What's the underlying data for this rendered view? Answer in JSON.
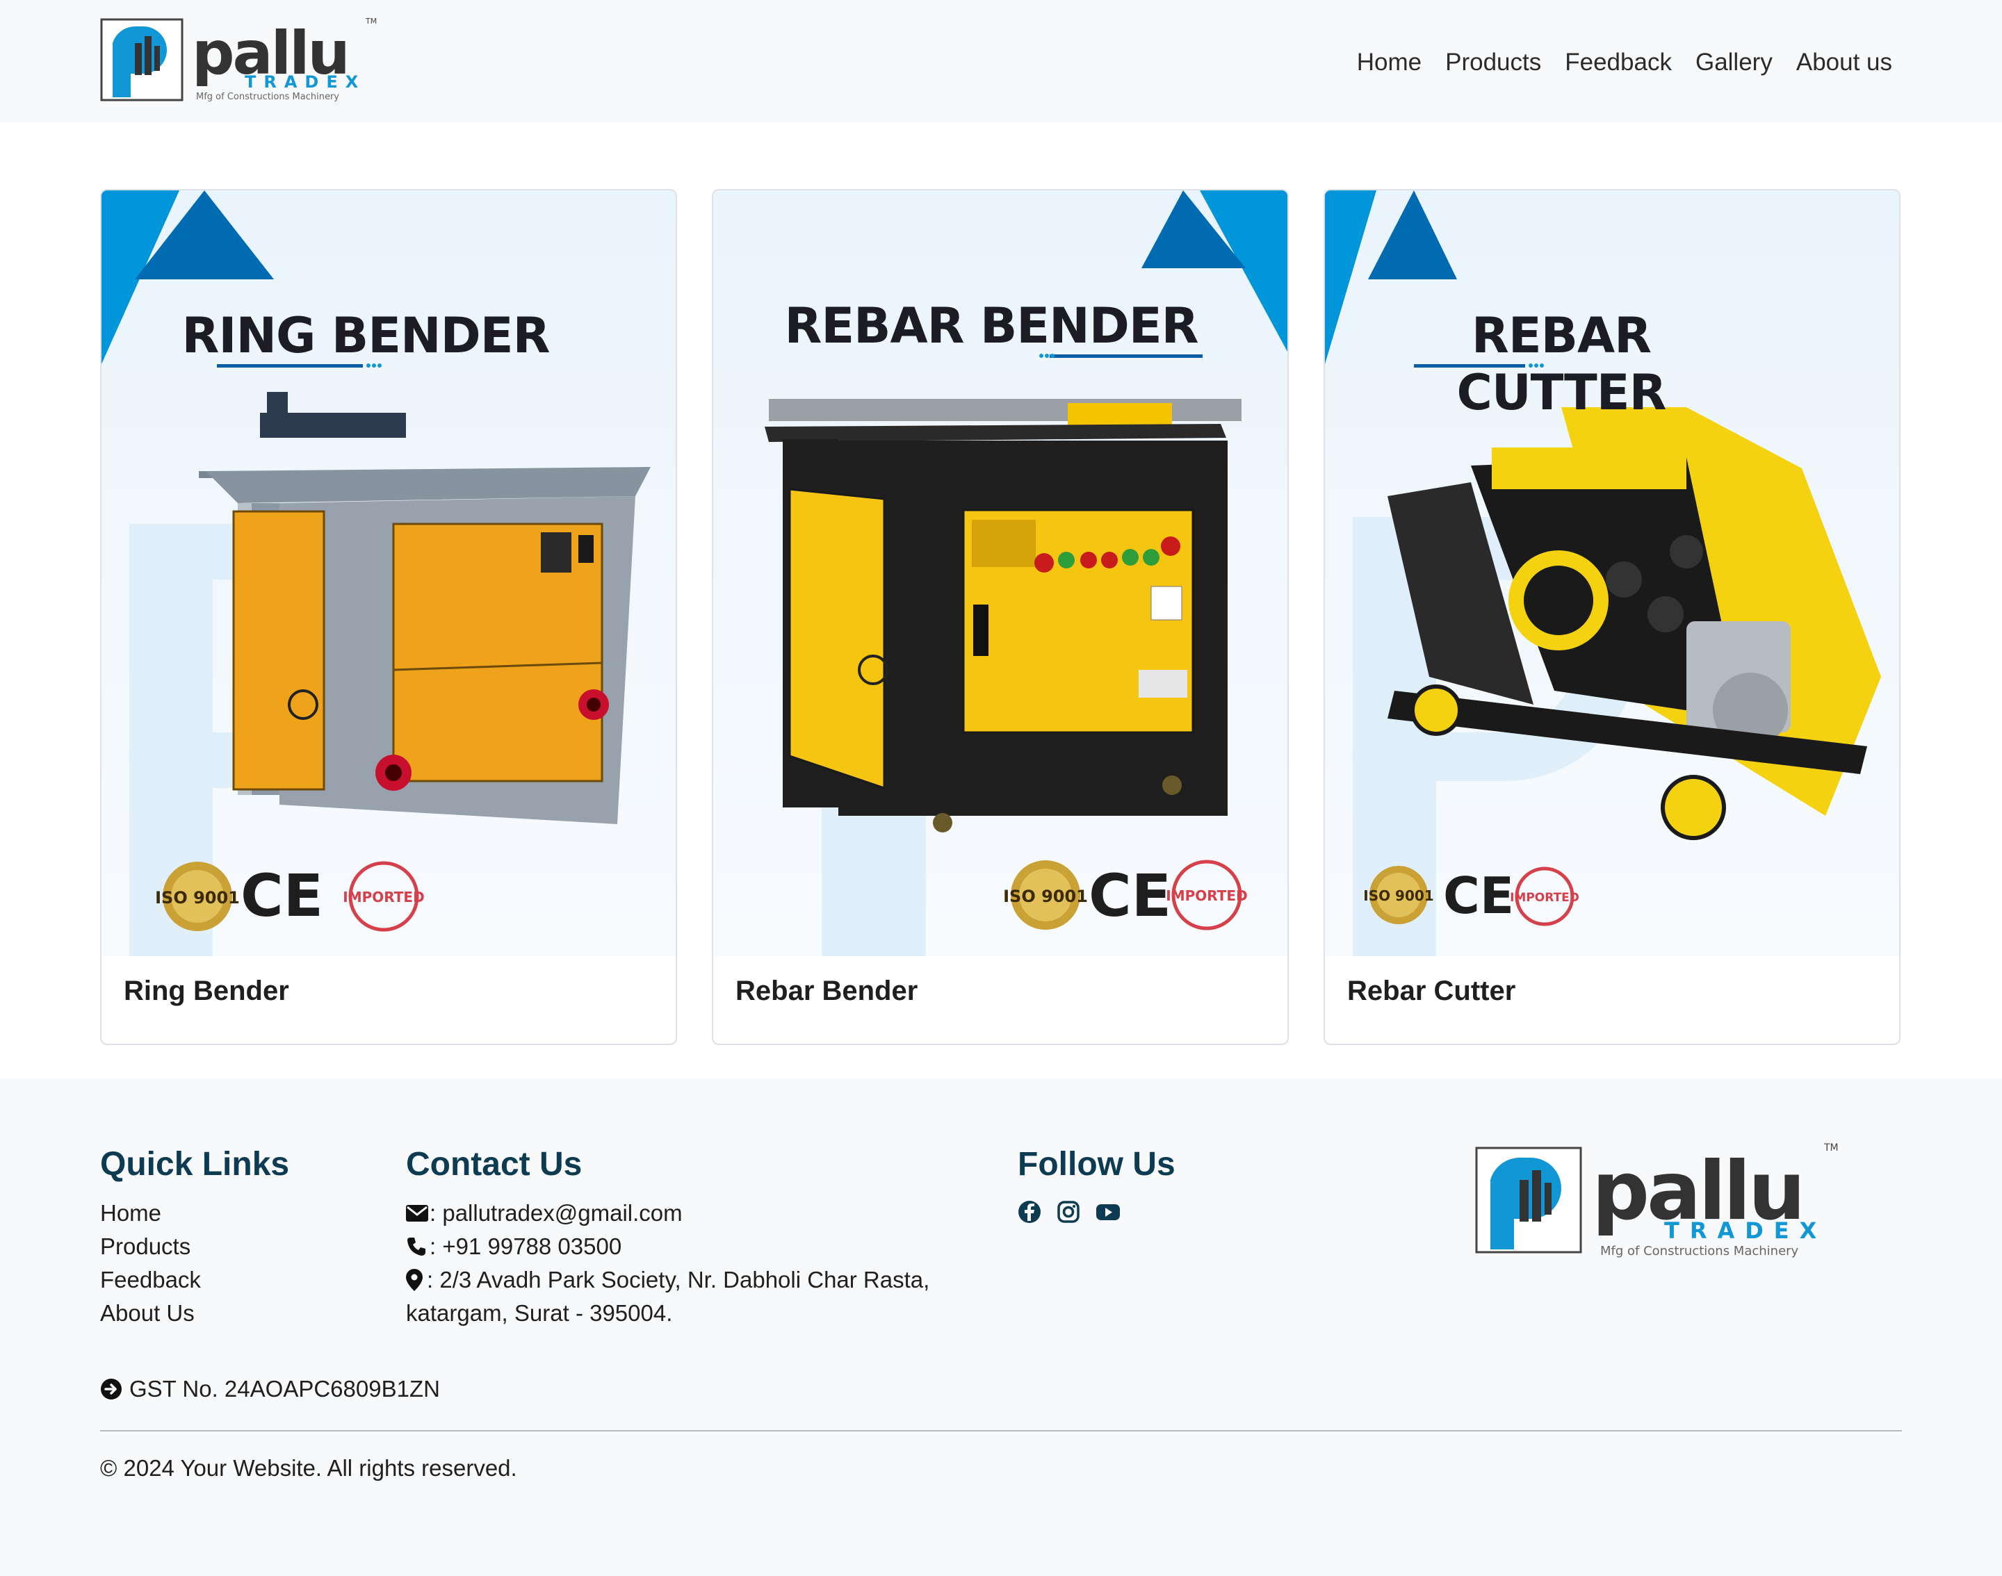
{
  "brand": {
    "name": "pallu",
    "sub": "TRADEX",
    "tagline": "Mfg of Constructions Machinery",
    "tm": "TM",
    "colors": {
      "blue": "#1297d6",
      "dark": "#333333"
    }
  },
  "nav": {
    "items": [
      "Home",
      "Products",
      "Feedback",
      "Gallery",
      "About us"
    ]
  },
  "products": [
    {
      "poster_title": "RING BENDER",
      "title": "Ring Bender",
      "badges": {
        "iso": "ISO 9001",
        "ce": "CE",
        "stamp": "IMPORTED"
      }
    },
    {
      "poster_title": "REBAR BENDER",
      "title": "Rebar Bender",
      "badges": {
        "iso": "ISO 9001",
        "ce": "CE",
        "stamp": "IMPORTED"
      }
    },
    {
      "poster_title": "REBAR CUTTER",
      "title": "Rebar Cutter",
      "badges": {
        "iso": "ISO 9001",
        "ce": "CE",
        "stamp": "IMPORTED"
      }
    }
  ],
  "footer": {
    "quick_links": {
      "heading": "Quick Links",
      "items": [
        "Home",
        "Products",
        "Feedback",
        "About Us"
      ]
    },
    "contact": {
      "heading": "Contact Us",
      "email": ": pallutradex@gmail.com",
      "phone": ": +91 99788 03500",
      "address_1": ": 2/3 Avadh Park Society, Nr. Dabholi Char Rasta,",
      "address_2": "katargam, Surat - 395004."
    },
    "follow": {
      "heading": "Follow Us",
      "icons": [
        "facebook-icon",
        "instagram-icon",
        "youtube-icon"
      ]
    },
    "gst": "GST No. 24AOAPC6809B1ZN",
    "copyright": "© 2024 Your Website. All rights reserved."
  },
  "colors": {
    "accent": "#0d3b52",
    "poster_blue": "#0096d9",
    "poster_dark_blue": "#006bb0",
    "machine_yellow": "#f2b705"
  }
}
